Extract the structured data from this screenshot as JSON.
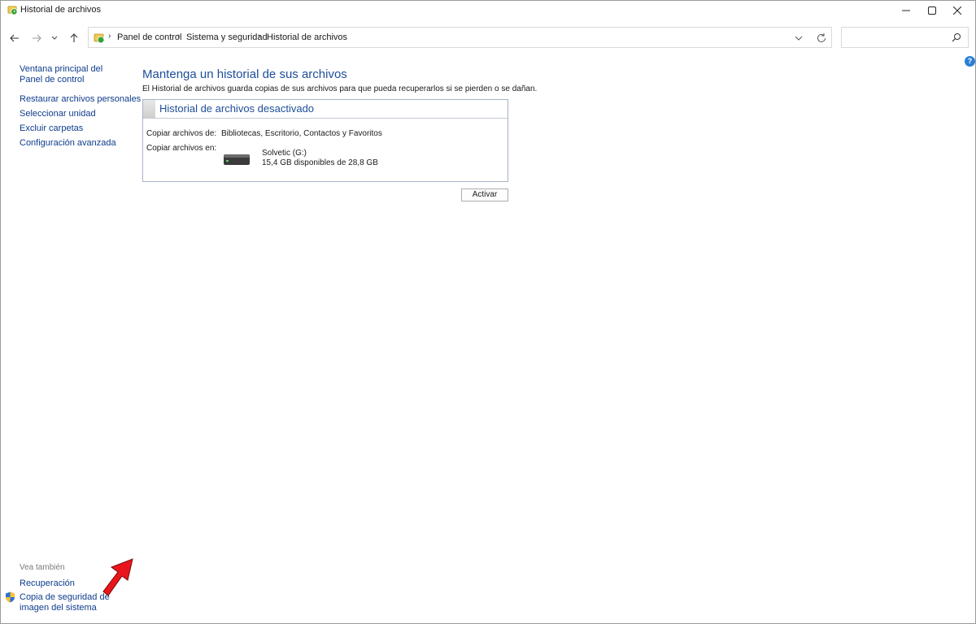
{
  "window": {
    "title": "Historial de archivos"
  },
  "breadcrumb": [
    "Panel de control",
    "Sistema y seguridad",
    "Historial de archivos"
  ],
  "search": {
    "placeholder": ""
  },
  "sidebar": {
    "links": [
      "Ventana principal del Panel de control",
      "Restaurar archivos personales",
      "Seleccionar unidad",
      "Excluir carpetas",
      "Configuración avanzada"
    ],
    "see_also_label": "Vea también",
    "see_also_links": [
      "Recuperación",
      "Copia de seguridad de imagen del sistema"
    ]
  },
  "main": {
    "heading": "Mantenga un historial de sus archivos",
    "description": "El Historial de archivos guarda copias de sus archivos para que pueda recuperarlos si se pierden o se dañan.",
    "status": {
      "title": "Historial de archivos desactivado",
      "copy_from_label": "Copiar archivos de:",
      "copy_from_value": "Bibliotecas, Escritorio, Contactos y Favoritos",
      "copy_to_label": "Copiar archivos en:",
      "drive_name": "Solvetic (G:)",
      "drive_space": "15,4 GB disponibles de 28,8 GB"
    },
    "activate_label": "Activar"
  },
  "icons": {
    "app": "file-history-icon",
    "back": "back-arrow-icon",
    "forward": "forward-arrow-icon",
    "recent": "chevron-down-icon",
    "up": "up-arrow-icon",
    "refresh": "refresh-icon",
    "search": "search-icon",
    "help": "help-icon",
    "shield": "shield-icon",
    "drive": "drive-icon"
  },
  "colors": {
    "link": "#0e3c8c",
    "heading": "#1e4e9a",
    "annotation_arrow": "#e8161b"
  }
}
